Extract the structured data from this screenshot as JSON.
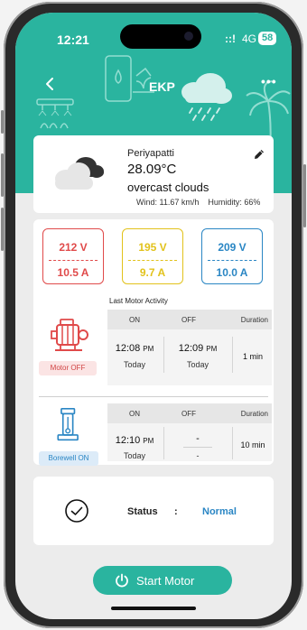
{
  "status_bar": {
    "time": "12:21",
    "signal": "::!",
    "network": "4G",
    "battery": "58"
  },
  "header": {
    "title": "EKP"
  },
  "weather": {
    "city": "Periyapatti",
    "temperature": "28.09°C",
    "description": "overcast clouds",
    "wind": "Wind: 11.67 km/h",
    "humidity": "Humidity: 66%"
  },
  "readings": [
    {
      "voltage": "212 V",
      "current": "10.5 A",
      "color": "#e04a4a"
    },
    {
      "voltage": "195 V",
      "current": "9.7 A",
      "color": "#e2c21b"
    },
    {
      "voltage": "209 V",
      "current": "10.0 A",
      "color": "#2a86c4"
    }
  ],
  "activity": {
    "title": "Last Motor Activity",
    "columns": [
      "ON",
      "OFF",
      "Duration"
    ],
    "motor": {
      "status_label": "Motor OFF",
      "on_time": "12:08",
      "on_period": "PM",
      "on_day": "Today",
      "off_time": "12:09",
      "off_period": "PM",
      "off_day": "Today",
      "duration": "1 min"
    },
    "borewell": {
      "status_label": "Borewell ON",
      "on_time": "12:10",
      "on_period": "PM",
      "on_day": "Today",
      "off_time": "-",
      "off_day": "-",
      "duration": "10 min"
    }
  },
  "status": {
    "label": "Status",
    "separator": ":",
    "value": "Normal"
  },
  "actions": {
    "start_motor": "Start Motor"
  },
  "colors": {
    "accent": "#2ab49f",
    "motor_off_bg": "#fbe4e4",
    "motor_off_text": "#d14444",
    "borewell_on_bg": "#dcebf8",
    "borewell_on_text": "#2a86c4",
    "status_normal": "#2a86c4"
  }
}
